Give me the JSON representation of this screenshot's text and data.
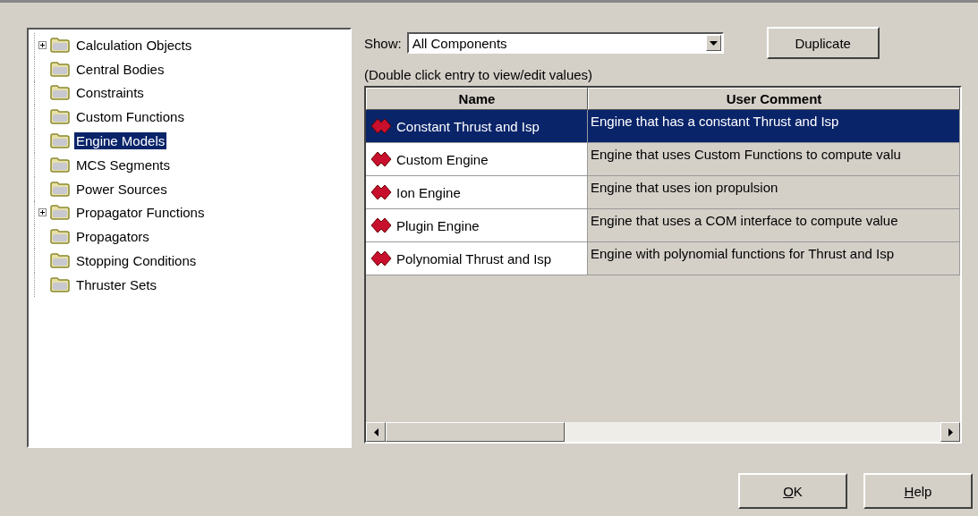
{
  "tree": {
    "items": [
      {
        "label": "Calculation Objects",
        "expandable": true,
        "selected": false
      },
      {
        "label": "Central Bodies",
        "expandable": false,
        "selected": false
      },
      {
        "label": "Constraints",
        "expandable": false,
        "selected": false
      },
      {
        "label": "Custom Functions",
        "expandable": false,
        "selected": false
      },
      {
        "label": "Engine Models",
        "expandable": false,
        "selected": true
      },
      {
        "label": "MCS Segments",
        "expandable": false,
        "selected": false
      },
      {
        "label": "Power Sources",
        "expandable": false,
        "selected": false
      },
      {
        "label": "Propagator Functions",
        "expandable": true,
        "selected": false
      },
      {
        "label": "Propagators",
        "expandable": false,
        "selected": false
      },
      {
        "label": "Stopping Conditions",
        "expandable": false,
        "selected": false
      },
      {
        "label": "Thruster Sets",
        "expandable": false,
        "selected": false
      }
    ]
  },
  "show": {
    "label": "Show:",
    "value": "All Components"
  },
  "duplicate_button": "Duplicate",
  "hint": "(Double click entry to view/edit values)",
  "table": {
    "columns": [
      "Name",
      "User Comment"
    ],
    "rows": [
      {
        "name": "Constant Thrust and Isp",
        "comment": "Engine that has a constant Thrust and Isp",
        "selected": true
      },
      {
        "name": "Custom Engine",
        "comment": "Engine that uses Custom Functions to compute valu",
        "selected": false
      },
      {
        "name": "Ion Engine",
        "comment": "Engine that uses ion propulsion",
        "selected": false
      },
      {
        "name": "Plugin Engine",
        "comment": "Engine that uses a COM interface to compute value",
        "selected": false
      },
      {
        "name": "Polynomial Thrust and Isp",
        "comment": "Engine with polynomial functions for Thrust and Isp",
        "selected": false
      }
    ]
  },
  "buttons": [
    {
      "label": "OK",
      "mnemonic": true
    },
    {
      "label": "Help",
      "mnemonic": true
    }
  ]
}
